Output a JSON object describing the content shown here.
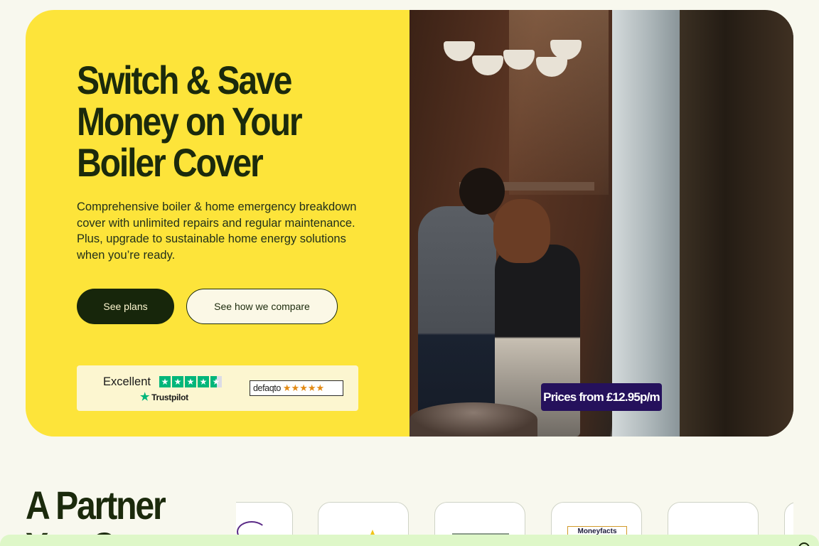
{
  "hero": {
    "title_lines": [
      "Switch & Save",
      "Money on Your",
      "Boiler Cover"
    ],
    "description": "Comprehensive boiler & home emergency breakdown cover with unlimited repairs and regular maintenance. Plus, upgrade to sustainable home energy solutions when you’re ready.",
    "primary_button": "See plans",
    "secondary_button": "See how we compare",
    "price_badge": "Prices from £12.95p/m",
    "colors": {
      "hero_bg": "#fde43a",
      "primary_button_bg": "#17260b",
      "badge_bg": "#25115c",
      "trustpilot_green": "#00b67a"
    }
  },
  "ratings": {
    "trustpilot_label": "Excellent",
    "trustpilot_brand": "Trustpilot",
    "trustpilot_stars": 4.5,
    "defaqto_brand": "defaqto",
    "defaqto_stars": "★★★★★",
    "defaqto_stars_value": 5
  },
  "partners": {
    "title_lines": [
      "A Partner",
      "You Ca"
    ],
    "logos": [
      {
        "icon": "ring-logo-icon"
      },
      {
        "icon": "flame-logo-icon"
      },
      {
        "icon": "line-logo-icon"
      },
      {
        "label": "Moneyfacts"
      },
      {
        "icon": "blank-logo-icon"
      },
      {
        "icon": "partial-logo-icon"
      }
    ]
  }
}
